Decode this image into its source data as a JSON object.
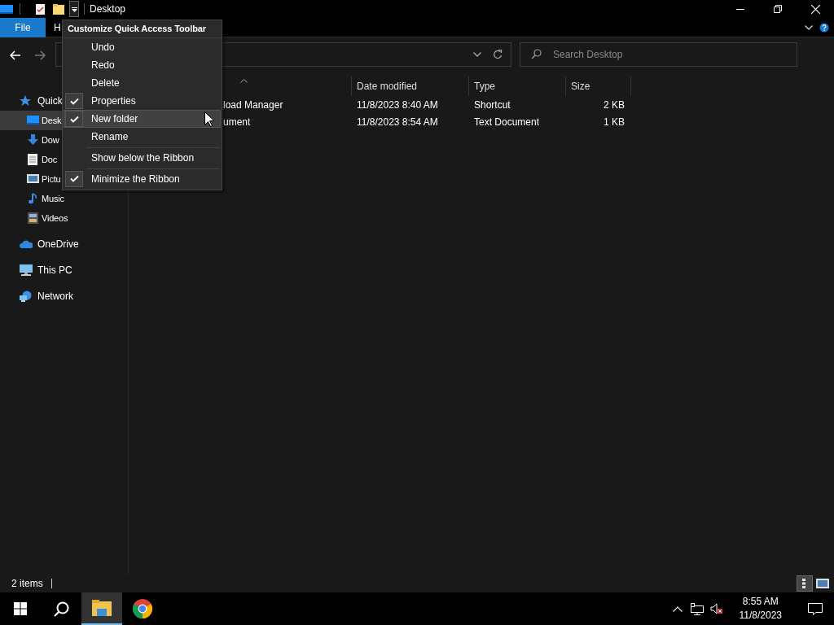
{
  "title_bar": {
    "title": "Desktop"
  },
  "ribbon": {
    "tabs": [
      {
        "label": "File",
        "kind": "file"
      },
      {
        "label": "H",
        "kind": "tab"
      }
    ]
  },
  "menu": {
    "title": "Customize Quick Access Toolbar",
    "items": [
      {
        "label": "Undo",
        "checked": false,
        "highlighted": false,
        "separator_before": false
      },
      {
        "label": "Redo",
        "checked": false,
        "highlighted": false,
        "separator_before": false
      },
      {
        "label": "Delete",
        "checked": false,
        "highlighted": false,
        "separator_before": false
      },
      {
        "label": "Properties",
        "checked": true,
        "highlighted": false,
        "separator_before": false
      },
      {
        "label": "New folder",
        "checked": true,
        "highlighted": true,
        "separator_before": false
      },
      {
        "label": "Rename",
        "checked": false,
        "highlighted": false,
        "separator_before": false
      },
      {
        "label": "Show below the Ribbon",
        "checked": false,
        "highlighted": false,
        "separator_before": true
      },
      {
        "label": "Minimize the Ribbon",
        "checked": true,
        "highlighted": false,
        "separator_before": true
      }
    ]
  },
  "search": {
    "placeholder": "Search Desktop"
  },
  "navigation": {
    "items": [
      {
        "label": "Quick",
        "selected": false,
        "children": [
          {
            "label": "Desk",
            "selected": true
          },
          {
            "label": "Dow",
            "selected": false
          },
          {
            "label": "Doc",
            "selected": false
          },
          {
            "label": "Pictu",
            "selected": false
          },
          {
            "label": "Music",
            "selected": false
          },
          {
            "label": "Videos",
            "selected": false
          }
        ]
      },
      {
        "label": "OneDrive",
        "selected": false
      },
      {
        "label": "This PC",
        "selected": false
      },
      {
        "label": "Network",
        "selected": false
      }
    ]
  },
  "table": {
    "columns": [
      "Date modified",
      "Type",
      "Size"
    ],
    "rows": [
      {
        "name": "load Manager",
        "date": "11/8/2023 8:40 AM",
        "type": "Shortcut",
        "size": "2 KB"
      },
      {
        "name": "ument",
        "date": "11/8/2023 8:54 AM",
        "type": "Text Document",
        "size": "1 KB"
      }
    ]
  },
  "status_bar": {
    "item_count": "2 items"
  },
  "taskbar": {
    "apps": [
      {
        "kind": "start",
        "active": false
      },
      {
        "kind": "search",
        "active": false
      },
      {
        "kind": "explorer",
        "active": true
      },
      {
        "kind": "chrome",
        "active": false
      }
    ],
    "clock": {
      "time": "8:55 AM",
      "date": "11/8/2023"
    }
  }
}
